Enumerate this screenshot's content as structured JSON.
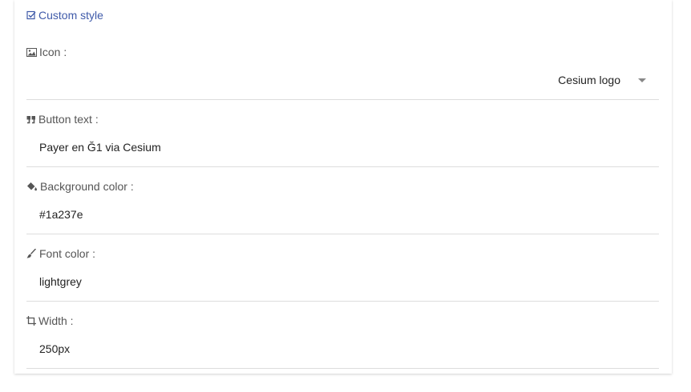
{
  "section": {
    "title": "Custom style",
    "icon": "checkbox-icon"
  },
  "fields": {
    "icon": {
      "label": "Icon :",
      "icon": "image-icon",
      "selected": "Cesium logo"
    },
    "button_text": {
      "label": "Button text :",
      "icon": "quote-icon",
      "value": "Payer en Ğ1 via Cesium"
    },
    "background_color": {
      "label": "Background color :",
      "icon": "paint-bucket-icon",
      "value": "#1a237e"
    },
    "font_color": {
      "label": "Font color :",
      "icon": "brush-icon",
      "value": "lightgrey"
    },
    "width": {
      "label": "Width :",
      "icon": "crop-icon",
      "value": "250px"
    }
  },
  "colors": {
    "accent": "#3f5aa9",
    "label": "#555555",
    "divider": "#dddddd"
  }
}
